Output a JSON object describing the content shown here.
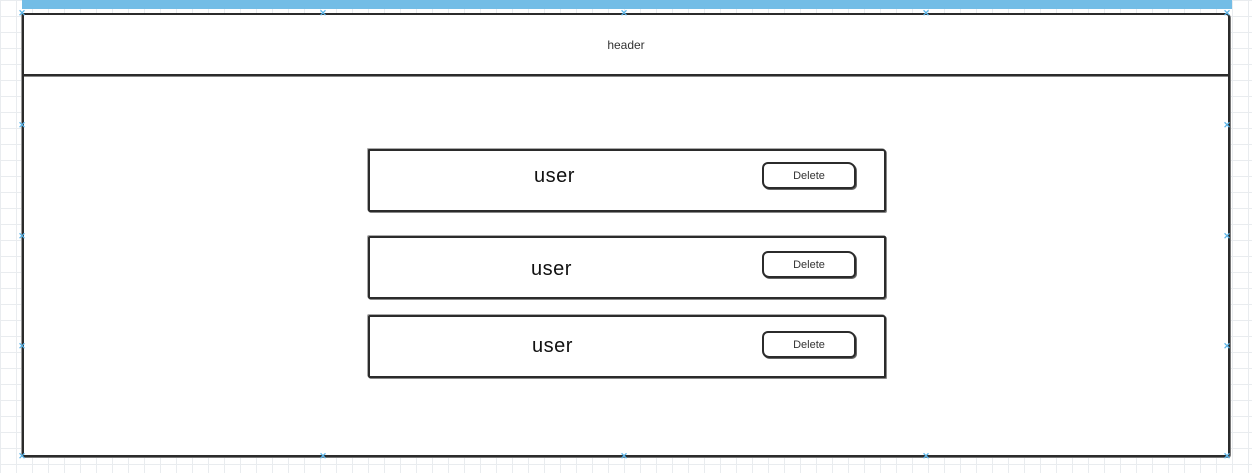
{
  "header": {
    "title": "header"
  },
  "users": [
    {
      "name": "user",
      "delete_label": "Delete"
    },
    {
      "name": "user",
      "delete_label": "Delete"
    },
    {
      "name": "user",
      "delete_label": "Delete"
    }
  ],
  "colors": {
    "selection": "#73bde6",
    "handle": "#5ab4e8",
    "stroke": "#2b2b2b",
    "grid": "#e9ecef"
  },
  "icons": {
    "selection_handle": "x-handle-icon"
  }
}
